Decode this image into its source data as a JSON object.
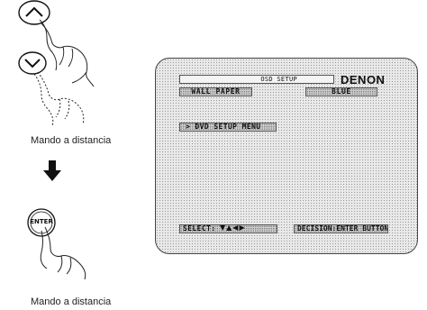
{
  "left_panel": {
    "up_button_icon": "up-chevron-button-icon",
    "down_button_icon": "down-chevron-button-icon",
    "enter_button_label": "ENTER",
    "caption_top": "Mando a distancia",
    "caption_bottom": "Mando a distancia",
    "arrow_icon": "down-arrow-icon"
  },
  "osd": {
    "title": "OSD SETUP",
    "brand": "DENON",
    "wallpaper_label": "WALL PAPER",
    "wallpaper_value": "BLUE",
    "menu_item": "> DVD SETUP MENU",
    "select_label": "SELECT:",
    "select_arrows": "▼▲◀▶",
    "decision_label": "DECISION:ENTER BUTTON"
  }
}
